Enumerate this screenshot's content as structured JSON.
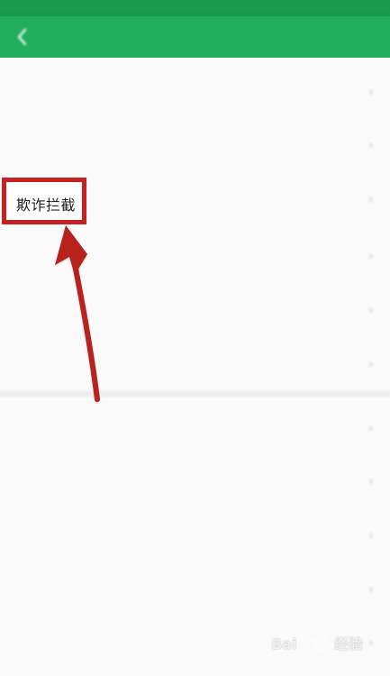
{
  "status_bar": {
    "left": "",
    "right": ""
  },
  "header": {
    "title": ""
  },
  "list": {
    "items": [
      {
        "label": ""
      },
      {
        "label": ""
      },
      {
        "label": "欺诈拦截"
      },
      {
        "label": ""
      },
      {
        "label": ""
      },
      {
        "label": ""
      },
      {
        "label": ""
      },
      {
        "label": ""
      },
      {
        "label": ""
      },
      {
        "label": ""
      },
      {
        "label": ""
      }
    ]
  },
  "annotation": {
    "highlighted_item": "欺诈拦截",
    "highlight_color": "#c62222"
  },
  "colors": {
    "header_green": "#20ad5c",
    "status_green": "#189a4f",
    "background": "#fafafa"
  },
  "watermark": {
    "text_left": "Bai",
    "text_right": "经验"
  }
}
